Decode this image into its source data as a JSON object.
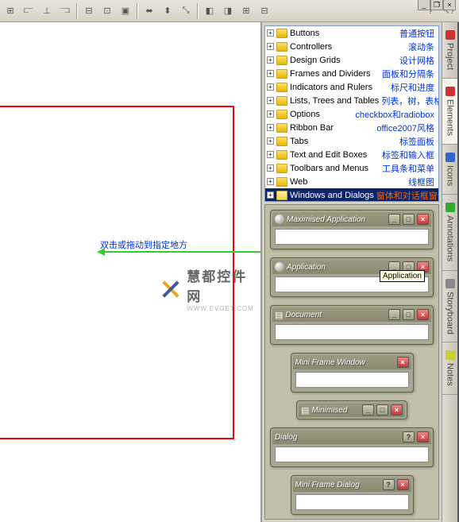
{
  "window_controls": {
    "minimize": "_",
    "restore": "❐",
    "close": "×"
  },
  "hint": "双击或拖动到指定地方",
  "watermark": {
    "text": "慧都控件网",
    "sub": "WWW.EVGET.COM"
  },
  "tooltip": "Application",
  "tree": [
    {
      "label": "Buttons",
      "anno": "普通按钮"
    },
    {
      "label": "Controllers",
      "anno": "滚动条"
    },
    {
      "label": "Design Grids",
      "anno": "设计网格"
    },
    {
      "label": "Frames and Dividers",
      "anno": "面板和分隔条"
    },
    {
      "label": "Indicators and Rulers",
      "anno": "标尺和进度"
    },
    {
      "label": "Lists, Trees and Tables",
      "anno": "列表，树，表格"
    },
    {
      "label": "Options",
      "anno": "checkbox和radiobox"
    },
    {
      "label": "Ribbon Bar",
      "anno": "office2007风格"
    },
    {
      "label": "Tabs",
      "anno": "标签面板"
    },
    {
      "label": "Text and Edit Boxes",
      "anno": "标签和输入框"
    },
    {
      "label": "Toolbars and Menus",
      "anno": "工具条和菜单"
    },
    {
      "label": "Web",
      "anno": "线框图"
    },
    {
      "label": "Windows and Dialogs",
      "anno": "窗体和对话框窗体",
      "selected": true
    }
  ],
  "elements": [
    {
      "title": "Maximised Application",
      "type": "full",
      "buttons": [
        "min",
        "max",
        "close"
      ],
      "icon": true
    },
    {
      "title": "Application",
      "type": "full",
      "buttons": [
        "min",
        "max",
        "close"
      ],
      "icon": true
    },
    {
      "title": "Document",
      "type": "full",
      "buttons": [
        "min",
        "max",
        "close"
      ],
      "doc": true
    },
    {
      "title": "Mini Frame Window",
      "type": "mini",
      "buttons": [
        "close"
      ]
    },
    {
      "title": "Minimised",
      "type": "small",
      "buttons": [
        "min",
        "max",
        "close"
      ],
      "doc": true
    },
    {
      "title": "Dialog",
      "type": "full",
      "buttons": [
        "help",
        "close"
      ]
    },
    {
      "title": "Mini Frame Dialog",
      "type": "mini",
      "buttons": [
        "help",
        "close"
      ]
    }
  ],
  "side_tabs": [
    {
      "label": "Project",
      "color": "#c33"
    },
    {
      "label": "Elements",
      "color": "#c33",
      "active": true
    },
    {
      "label": "Icons",
      "color": "#36c"
    },
    {
      "label": "Annotations",
      "color": "#3a3"
    },
    {
      "label": "Storyboard",
      "color": "#888"
    },
    {
      "label": "Notes",
      "color": "#cc3"
    }
  ]
}
